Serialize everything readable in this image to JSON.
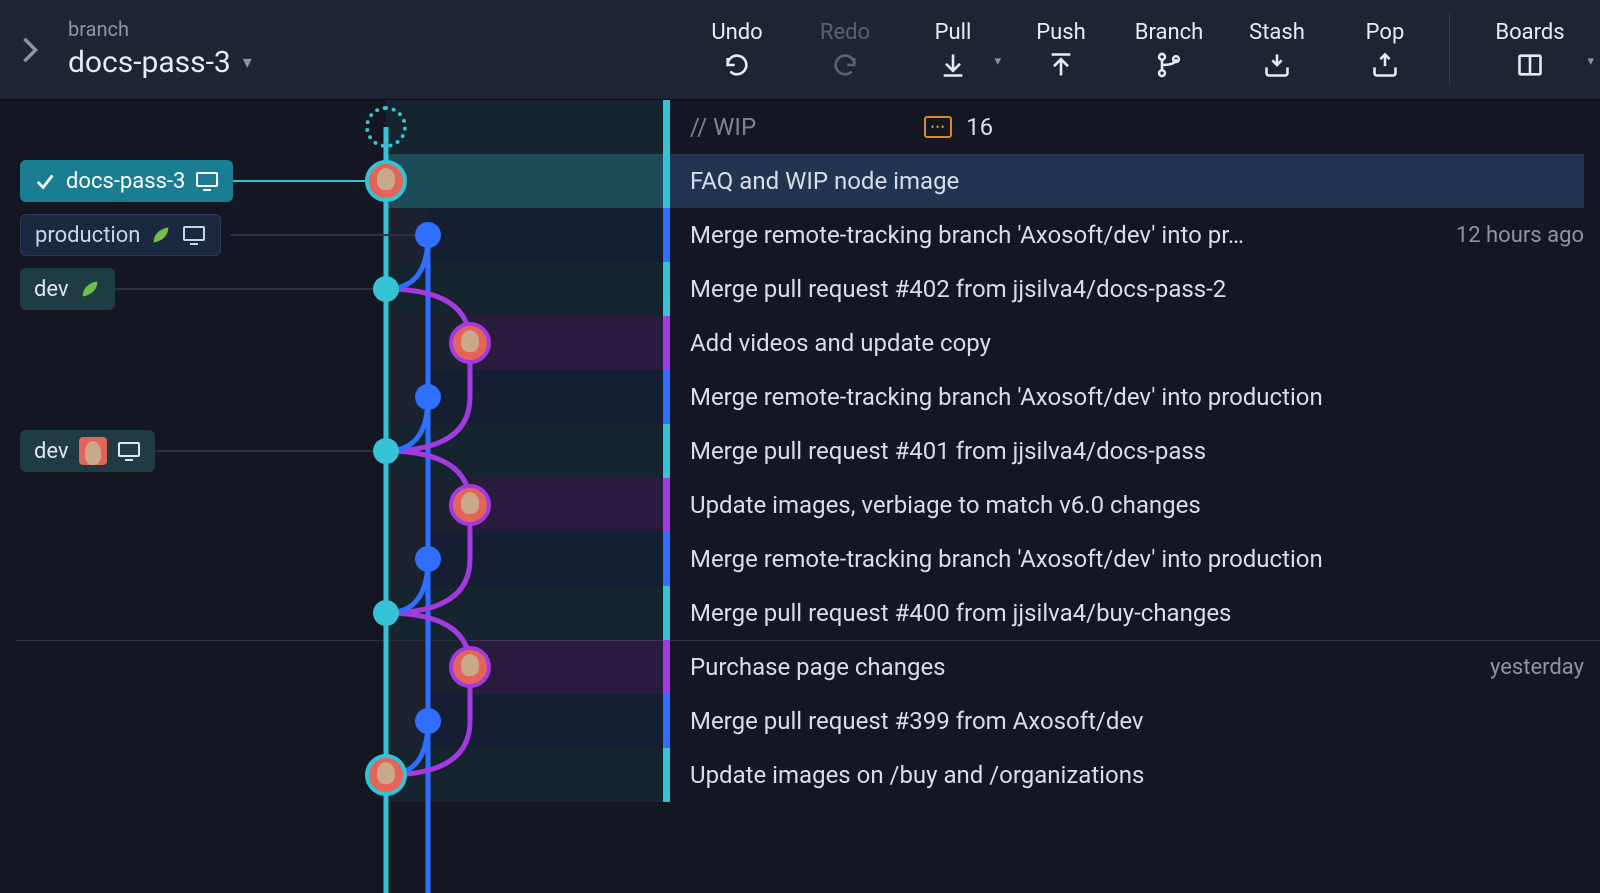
{
  "toolbar": {
    "branch_label": "branch",
    "branch_name": "docs-pass-3",
    "buttons": {
      "undo": "Undo",
      "redo": "Redo",
      "pull": "Pull",
      "push": "Push",
      "branch": "Branch",
      "stash": "Stash",
      "pop": "Pop",
      "boards": "Boards"
    }
  },
  "wip": {
    "label": "// WIP",
    "file_count": "16"
  },
  "refs": {
    "docs_pass_3": "docs-pass-3",
    "production": "production",
    "dev_local": "dev",
    "dev_remote": "dev"
  },
  "time": {
    "t12h": "12 hours ago",
    "yesterday": "yesterday"
  },
  "commits": [
    {
      "msg": "FAQ and WIP node image"
    },
    {
      "msg": "Merge remote-tracking branch 'Axosoft/dev' into pr…"
    },
    {
      "msg": "Merge pull request #402 from jjsilva4/docs-pass-2"
    },
    {
      "msg": "Add videos and update copy"
    },
    {
      "msg": "Merge remote-tracking branch 'Axosoft/dev' into production"
    },
    {
      "msg": "Merge pull request #401 from jjsilva4/docs-pass"
    },
    {
      "msg": "Update images, verbiage to match v6.0 changes"
    },
    {
      "msg": "Merge remote-tracking branch 'Axosoft/dev' into production"
    },
    {
      "msg": "Merge pull request #400 from jjsilva4/buy-changes"
    },
    {
      "msg": "Purchase page changes"
    },
    {
      "msg": "Merge pull request #399 from Axosoft/dev"
    },
    {
      "msg": "Update images on /buy and /organizations"
    }
  ]
}
